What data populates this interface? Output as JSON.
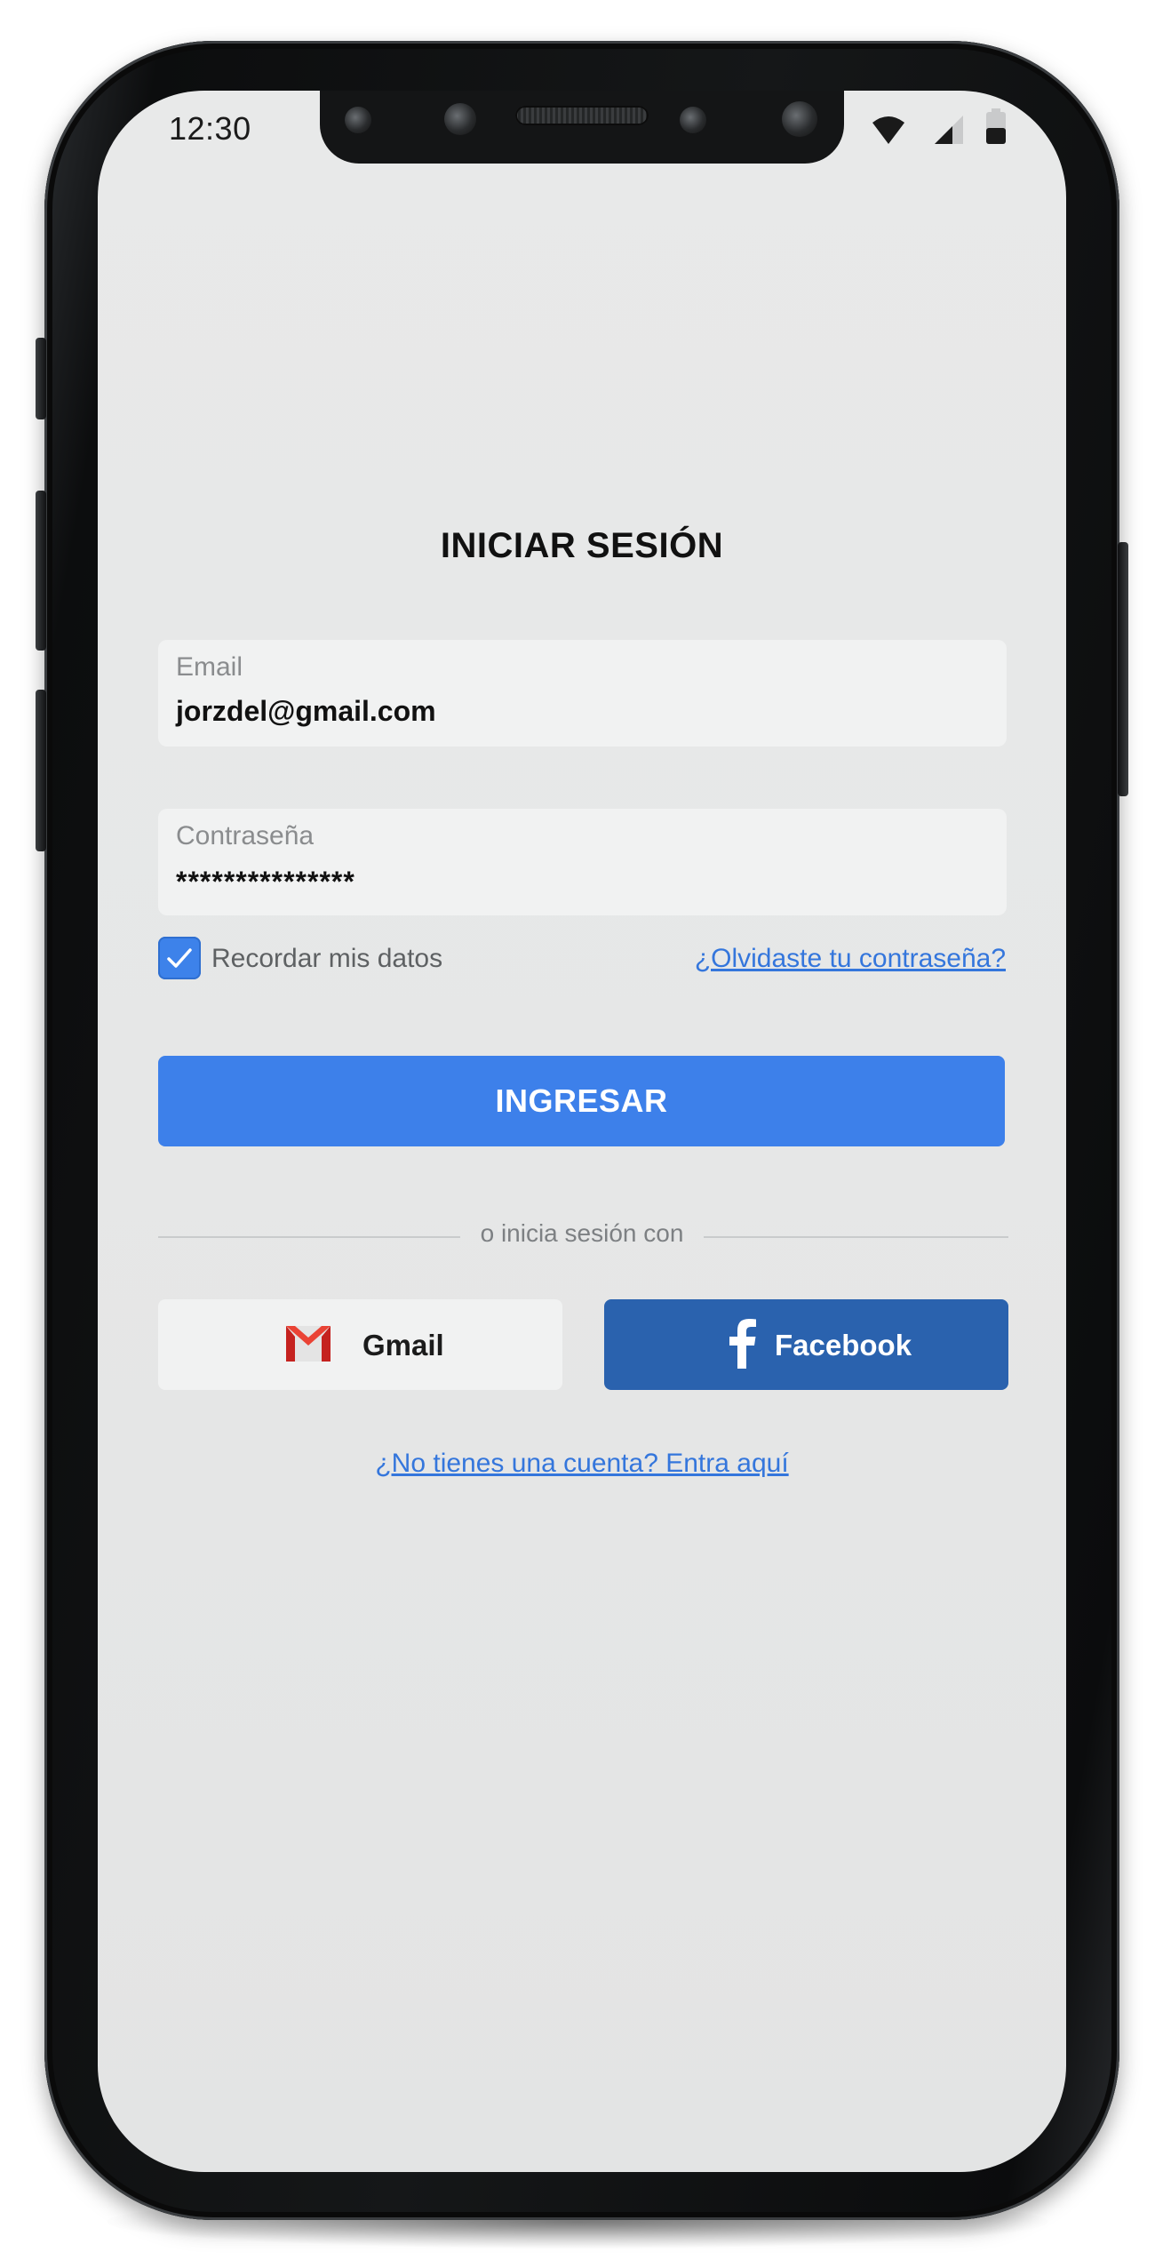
{
  "status_bar": {
    "time": "12:30",
    "icons": [
      "wifi-icon",
      "cellular-signal-icon",
      "battery-icon"
    ]
  },
  "login": {
    "title": "INICIAR SESIÓN",
    "email": {
      "label": "Email",
      "value": "jorzdel@gmail.com"
    },
    "password": {
      "label": "Contraseña",
      "value": "***************"
    },
    "remember": {
      "label": "Recordar mis datos",
      "checked": true
    },
    "forgot_link": "¿Olvidaste tu contraseña?",
    "submit_label": "INGRESAR",
    "divider_text": "o inicia sesión con",
    "social": {
      "gmail_label": "Gmail",
      "facebook_label": "Facebook"
    },
    "signup_link": "¿No tienes una cuenta? Entra aquí"
  },
  "colors": {
    "primary": "#3d80ea",
    "link": "#3476dc",
    "facebook": "#2a62ae",
    "gmail_red": "#d93025",
    "screen_bg": "#e6e7e7",
    "field_bg": "#f1f2f2"
  }
}
